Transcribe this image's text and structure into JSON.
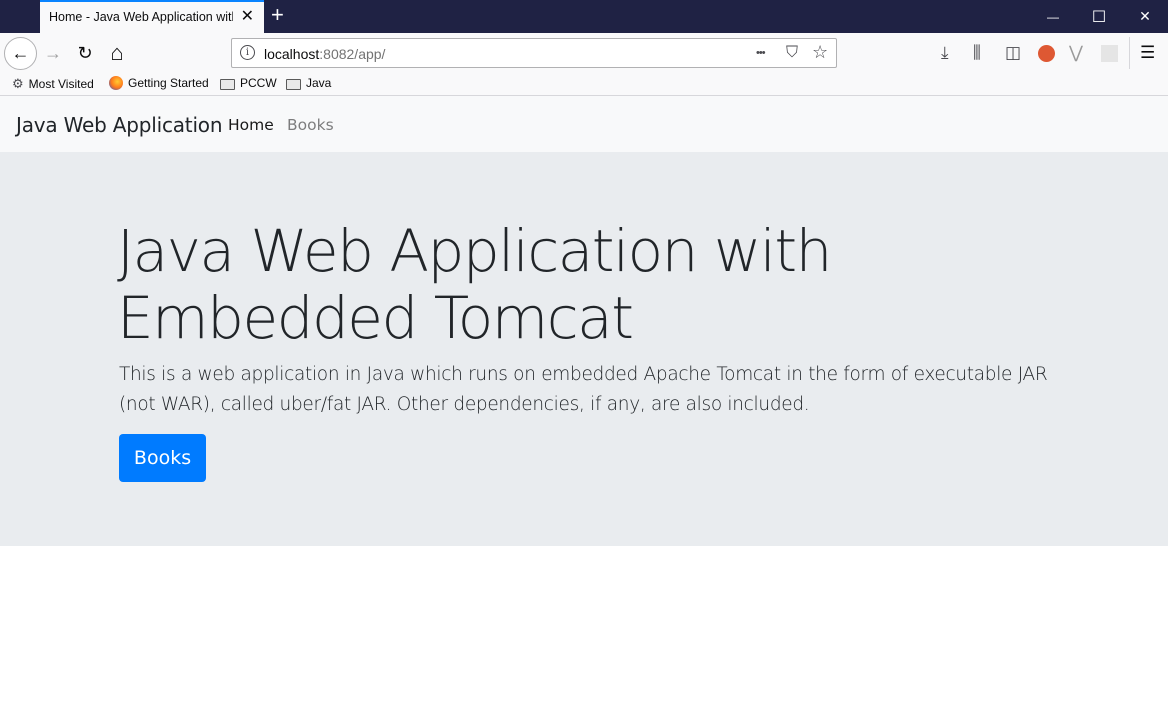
{
  "browser": {
    "tab_title": "Home - Java Web Application with Embedded Tomcat",
    "url_host": "localhost",
    "url_rest": ":8082/app/",
    "bookmarks": [
      {
        "label": "Most Visited",
        "icon": "gear-icon"
      },
      {
        "label": "Getting Started",
        "icon": "firefox-icon"
      },
      {
        "label": "PCCW",
        "icon": "folder-icon"
      },
      {
        "label": "Java",
        "icon": "folder-icon"
      }
    ],
    "glyphs": {
      "close": "✕",
      "new_tab": "+",
      "minimize": "—",
      "maximize": "☐",
      "window_close": "✕",
      "back": "←",
      "forward": "→",
      "reload": "↻",
      "home": "⌂",
      "info": "i",
      "more": "•••",
      "pocket": "⛉",
      "star": "☆",
      "download": "⤓",
      "library": "⫼",
      "sidebar": "◫",
      "vivaldi": "⋁",
      "menu": "☰",
      "gear": "⚙"
    }
  },
  "navbar": {
    "brand": "Java Web Application",
    "links": [
      {
        "label": "Home",
        "active": true
      },
      {
        "label": "Books",
        "active": false
      }
    ]
  },
  "jumbotron": {
    "title": "Java Web Application with Embedded Tomcat",
    "lead": "This is a web application in Java which runs on embedded Apache Tomcat in the form of executable JAR (not WAR), called uber/fat JAR. Other dependencies, if any, are also included.",
    "button_label": "Books",
    "button_color": "#007bff"
  }
}
